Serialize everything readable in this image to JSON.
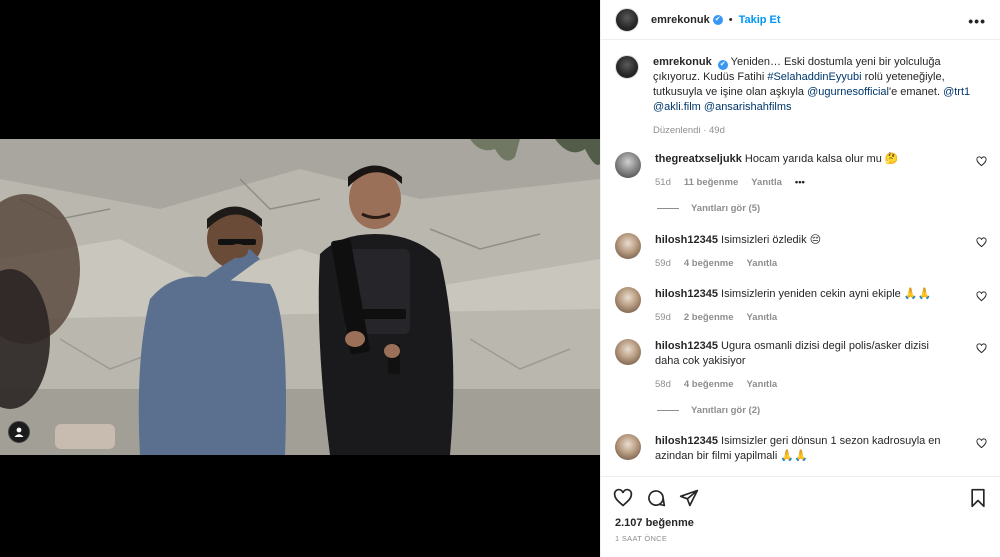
{
  "post": {
    "username": "emrekonuk",
    "verified_mark": "✔",
    "follow_label": "Takip Et",
    "more_label": "•••",
    "caption_text": "Yeniden… Eski dostumla yeni bir yolculuğa çıkıyoruz. Kudüs Fatihi ",
    "caption_tag1": "#SelahaddinEyyubi",
    "caption_mid": " rolü yeteneğiyle, tutkusuyla ve işine olan aşkıyla ",
    "caption_mention1": "@ugurnesofficial",
    "caption_mid2": "'e emanet. ",
    "caption_mention2": "@trt1",
    "caption_mention3": "@akli.film",
    "caption_mention4": "@ansarishahfilms",
    "edited_label": "Düzenlendi",
    "edited_age": "49d"
  },
  "comments": [
    {
      "user": "thegreatxseljukk",
      "text": "Hocam yarıda kalsa olur mu 🤔",
      "age": "51d",
      "likes": "11 beğenme",
      "reply": "Yanıtla",
      "more": "•••"
    },
    {
      "user": "hilosh12345",
      "text": "Isimsizleri özledik 😔",
      "age": "59d",
      "likes": "4 beğenme",
      "reply": "Yanıtla"
    },
    {
      "user": "hilosh12345",
      "text": "Isimsizlerin yeniden cekin ayni ekiple 🙏🙏",
      "age": "59d",
      "likes": "2 beğenme",
      "reply": "Yanıtla"
    },
    {
      "user": "hilosh12345",
      "text": "Ugura osmanli dizisi degil polis/asker dizisi daha cok yakisiyor",
      "age": "58d",
      "likes": "4 beğenme",
      "reply": "Yanıtla"
    },
    {
      "user": "hilosh12345",
      "text": "Isimsizler geri dönsun 1 sezon kadrosuyla en azindan bir filmi yapilmali 🙏🙏",
      "age": "",
      "likes": "",
      "reply": ""
    }
  ],
  "replies": [
    {
      "label": "Yanıtları gör (5)"
    },
    {
      "label": "Yanıtları gör (2)"
    }
  ],
  "footer": {
    "likes": "2.107 beğenme",
    "time": "1 SAAT ÖNCE"
  },
  "icons": {
    "like": "heart-icon",
    "comment": "comment-icon",
    "share": "share-icon",
    "save": "bookmark-icon",
    "tag": "user-tag-icon"
  },
  "colors": {
    "accent": "#0095f6",
    "link": "#00376b",
    "muted": "#8e8e8e"
  }
}
